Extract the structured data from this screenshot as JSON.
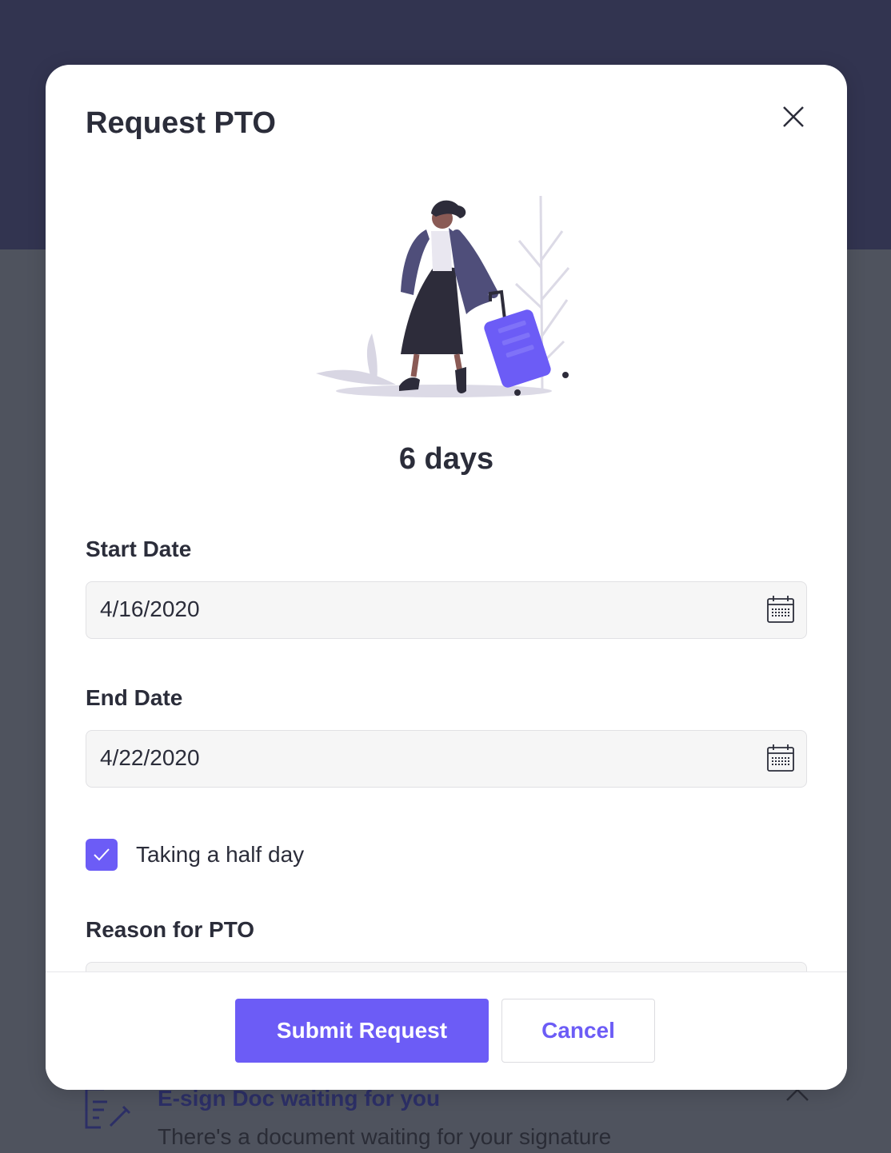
{
  "background": {
    "notice": {
      "title": "E-sign Doc waiting for you",
      "body": "There's a document waiting for your signature",
      "icon": "document-edit-icon"
    }
  },
  "modal": {
    "title": "Request PTO",
    "close_icon": "close-icon",
    "illustration": "traveler-with-suitcase",
    "duration": "6 days",
    "start_date": {
      "label": "Start Date",
      "value": "4/16/2020",
      "icon": "calendar-icon"
    },
    "end_date": {
      "label": "End Date",
      "value": "4/22/2020",
      "icon": "calendar-icon"
    },
    "half_day": {
      "label": "Taking a half day",
      "checked": true
    },
    "reason": {
      "label": "Reason for PTO",
      "value": ""
    },
    "buttons": {
      "submit": "Submit Request",
      "cancel": "Cancel"
    }
  },
  "colors": {
    "accent": "#6c5cf6",
    "header_bg": "#323450",
    "overlay_bg": "#4f535e",
    "text": "#2b2d3a"
  }
}
